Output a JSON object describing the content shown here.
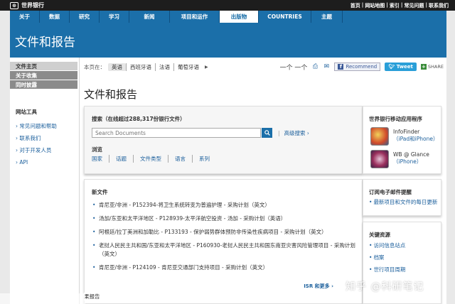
{
  "topbar": {
    "logo_text": "世界银行",
    "links": [
      "首页",
      "|",
      "网站地图",
      "|",
      "索引",
      "|",
      "常见问题",
      "|",
      "联系我们"
    ]
  },
  "nav": {
    "items": [
      "关于",
      "数据",
      "研究",
      "学习",
      "新闻",
      "项目和运作",
      "出版物",
      "COUNTRIES",
      "主题"
    ],
    "active": "出版物"
  },
  "banner": {
    "title": "文件和报告"
  },
  "sidebar": {
    "tabs": [
      "文件主页",
      "关于收集",
      "同时披露"
    ],
    "tools_heading": "网站工具",
    "tools": [
      "常见问题和帮助",
      "联系我们",
      "对于开发人员",
      "API"
    ]
  },
  "toolbar": {
    "label": "本页在：",
    "languages": [
      "英语",
      "西班牙语",
      "法语",
      "葡萄牙语"
    ],
    "size_text": "一个 一个",
    "recommend": "Recommend",
    "tweet": "Tweet",
    "share": "SHARE"
  },
  "main": {
    "title": "文件和报告",
    "search": {
      "heading": "搜索（在线超过288,317份银行文件）",
      "placeholder": "Search Documents",
      "advanced": "高级搜索",
      "browse_label": "浏览",
      "browse_links": [
        "国家",
        "话题",
        "文件类型",
        "语言",
        "系列"
      ]
    },
    "new_docs": {
      "heading": "新文件",
      "items": [
        "肯尼亚/非洲 - P152394-将卫生系统转变为普遍护理 - 采购计划（英文）",
        "汤加/东亚和太平洋地区 - P128939-太平洋航空投资 - 汤加 - 采购计划（英语）",
        "阿根廷/拉丁美洲和加勒比 - P133193 - 保护弱势群体预防非传染性疾病项目 - 采购计划（英文）",
        "老挝人民民主共和国/东亚和太平洋地区 - P160930-老挝人民民主共和国东南亚灾害风险管理项目 - 采购计划（英文）",
        "肯尼亚/非洲 - P124109 - 肯尼亚交通部门支持项目 - 采购计划（英文）"
      ],
      "more": "ISR 和更多",
      "cutoff_text": "果报告"
    }
  },
  "right": {
    "apps_heading": "世界银行移动应用程序",
    "apps": [
      {
        "name": "InfoFinder",
        "platform": "（iPad和iPhone）"
      },
      {
        "name": "WB @ Glance",
        "platform": "（iPhone）"
      }
    ],
    "subscribe_heading": "订阅电子邮件提醒",
    "subscribe_link": "最新项目和文件的每日更新",
    "resources_heading": "关键资源",
    "resources": [
      "访问信息站点",
      "档案",
      "世行项目周期"
    ]
  },
  "watermark": "知乎 @科研笔记"
}
